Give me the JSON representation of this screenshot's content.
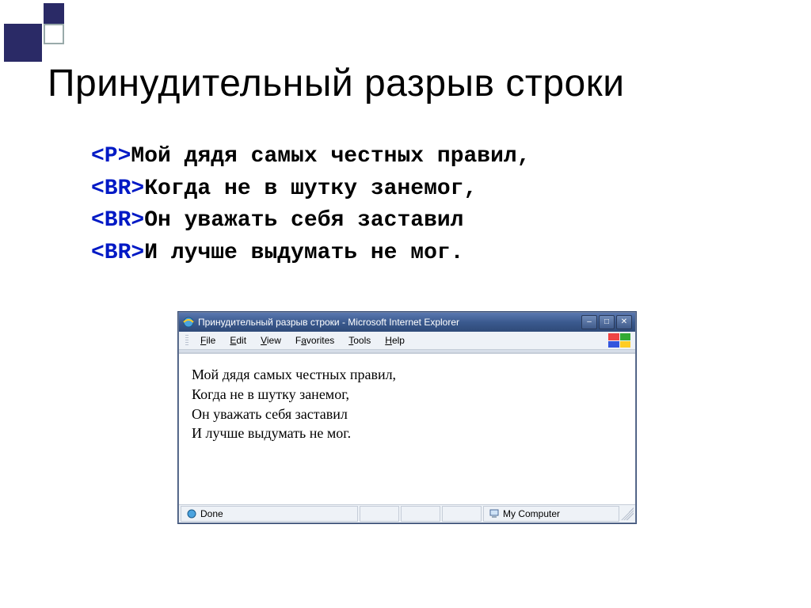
{
  "slide": {
    "title": "Принудительный разрыв строки"
  },
  "code": {
    "tag_p": "<P>",
    "line1": "Мой дядя самых честных правил,",
    "tag_br": "<BR>",
    "line2": "Когда не в шутку занемог,",
    "line3": "Он уважать себя заставил",
    "line4": "И лучше выдумать не мог."
  },
  "browser": {
    "title": "Принудительный разрыв строки - Microsoft Internet Explorer",
    "menus": {
      "file": "File",
      "edit": "Edit",
      "view": "View",
      "favorites": "Favorites",
      "tools": "Tools",
      "help": "Help"
    },
    "content": {
      "line1": "Мой дядя самых честных правил,",
      "line2": "Когда не в шутку занемог,",
      "line3": "Он уважать себя заставил",
      "line4": "И лучше выдумать не мог."
    },
    "status": {
      "done": "Done",
      "zone": "My Computer"
    }
  }
}
